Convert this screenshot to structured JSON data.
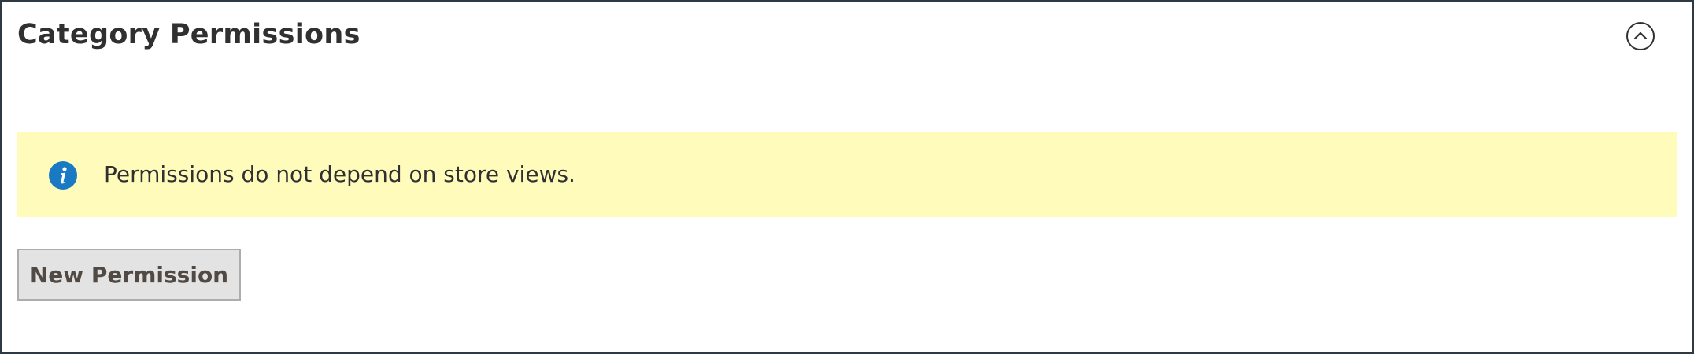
{
  "section": {
    "title": "Category Permissions",
    "collapse_icon": "chevron-up-circle-icon"
  },
  "message": {
    "icon": "info-icon",
    "text": "Permissions do not depend on store views.",
    "background_color": "#fffbbb",
    "icon_color": "#1979c3"
  },
  "actions": {
    "new_permission_label": "New Permission"
  }
}
